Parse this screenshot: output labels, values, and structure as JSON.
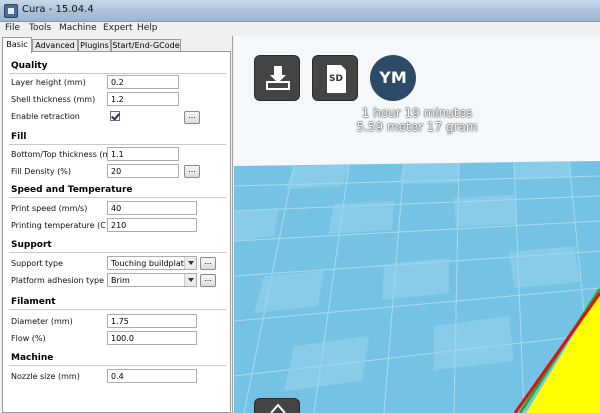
{
  "window": {
    "title": "Cura - 15.04.4"
  },
  "menu": [
    "File",
    "Tools",
    "Machine",
    "Expert",
    "Help"
  ],
  "tabs": [
    "Basic",
    "Advanced",
    "Plugins",
    "Start/End-GCode"
  ],
  "sections": {
    "quality": {
      "title": "Quality",
      "layer_height": {
        "label": "Layer height (mm)",
        "value": "0.2"
      },
      "shell_thickness": {
        "label": "Shell thickness (mm)",
        "value": "1.2"
      },
      "retraction": {
        "label": "Enable retraction",
        "checked": true,
        "button": "..."
      }
    },
    "fill": {
      "title": "Fill",
      "bottom_top": {
        "label": "Bottom/Top thickness (mm)",
        "value": "1.1"
      },
      "density": {
        "label": "Fill Density (%)",
        "value": "20",
        "button": "..."
      }
    },
    "speed": {
      "title": "Speed and Temperature",
      "print_speed": {
        "label": "Print speed (mm/s)",
        "value": "40"
      },
      "temperature": {
        "label": "Printing temperature (C)",
        "value": "210"
      }
    },
    "support": {
      "title": "Support",
      "type": {
        "label": "Support type",
        "value": "Touching buildplate",
        "button": "..."
      },
      "adhesion": {
        "label": "Platform adhesion type",
        "value": "Brim",
        "button": "..."
      }
    },
    "filament": {
      "title": "Filament",
      "diameter": {
        "label": "Diameter (mm)",
        "value": "1.75"
      },
      "flow": {
        "label": "Flow (%)",
        "value": "100.0"
      }
    },
    "machine": {
      "title": "Machine",
      "nozzle": {
        "label": "Nozzle size (mm)",
        "value": "0.4"
      }
    }
  },
  "viewport": {
    "sd_label": "SD",
    "ym_label": "YM",
    "print_time": "1 hour 19 minutes",
    "print_material": "5.59 meter 17 gram",
    "colors": {
      "bed_light": "#9fd7ef",
      "bed_dark": "#6cc0e2",
      "object": "#ffff00",
      "edge_green": "#22aa22",
      "edge_red": "#e01010"
    }
  }
}
